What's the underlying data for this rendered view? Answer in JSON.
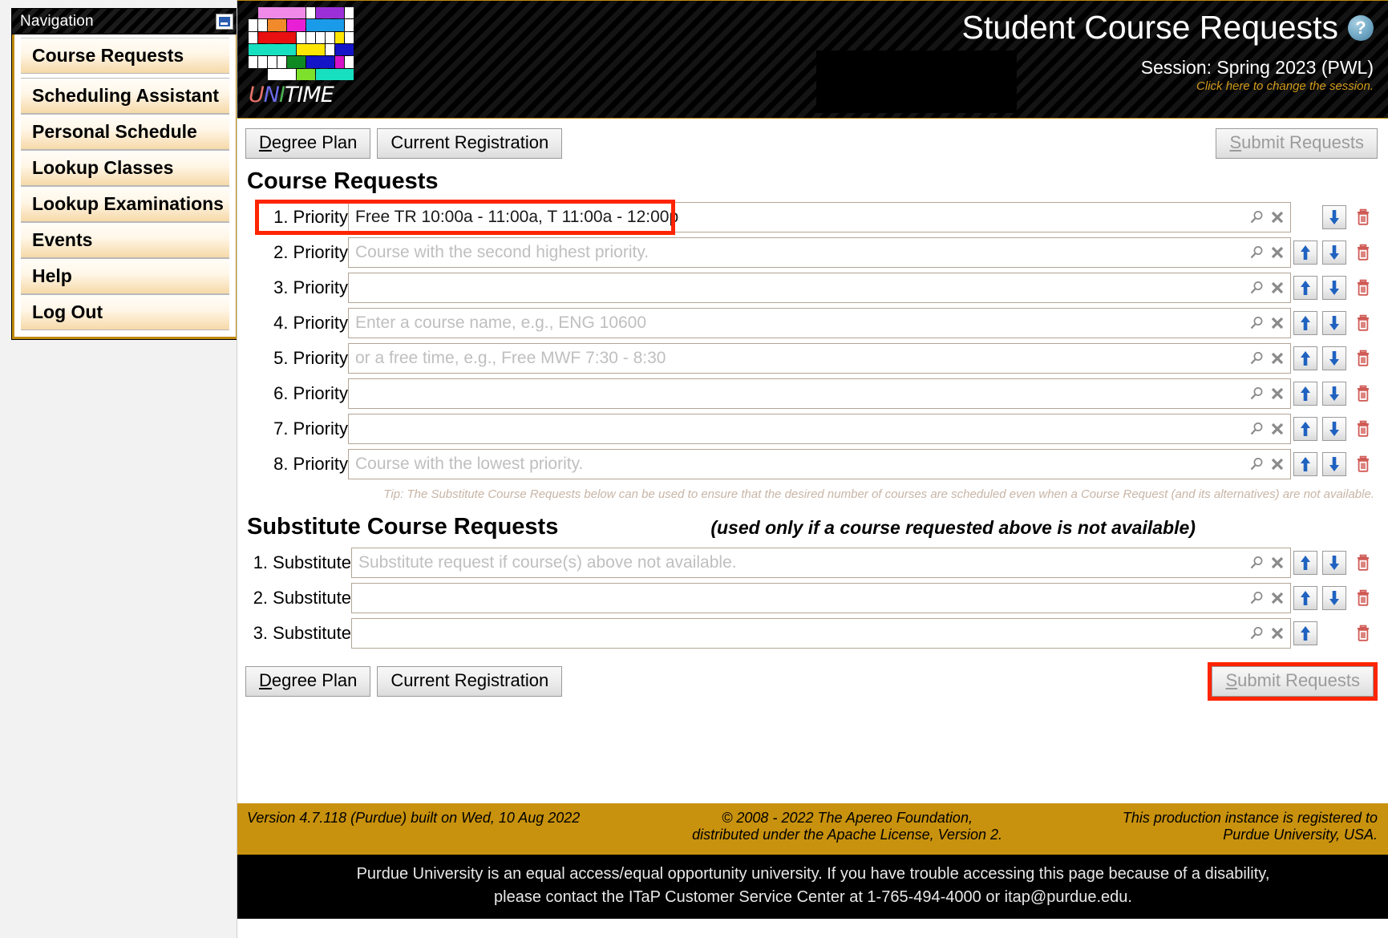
{
  "navigation": {
    "title": "Navigation",
    "minimize_icon": "minimize-icon",
    "items": [
      {
        "label": "Course Requests"
      },
      {
        "label": "Scheduling Assistant"
      },
      {
        "label": "Personal Schedule"
      },
      {
        "label": "Lookup Classes"
      },
      {
        "label": "Lookup Examinations"
      },
      {
        "label": "Events"
      },
      {
        "label": "Help"
      },
      {
        "label": "Log Out"
      }
    ]
  },
  "banner": {
    "logo_word": {
      "u": "U",
      "n": "N",
      "i": "I",
      "rest": "TIME"
    },
    "title": "Student Course Requests",
    "help_icon": "help-icon",
    "help_glyph": "?",
    "session": "Session: Spring 2023 (PWL)",
    "session_change": "Click here to change the session."
  },
  "toolbar": {
    "degree_plan_accesskey": "D",
    "degree_plan_rest": "egree Plan",
    "current_registration": "Current Registration",
    "submit_accesskey": "S",
    "submit_rest": "ubmit Requests"
  },
  "course_requests": {
    "heading": "Course Requests",
    "rows": [
      {
        "label": "1. Priority",
        "value": "Free TR 10:00a - 11:00a, T 11:00a - 12:00p",
        "placeholder": "",
        "up": false,
        "down": true,
        "delete": true
      },
      {
        "label": "2. Priority",
        "value": "",
        "placeholder": "Course with the second highest priority.",
        "up": true,
        "down": true,
        "delete": true
      },
      {
        "label": "3. Priority",
        "value": "",
        "placeholder": "",
        "up": true,
        "down": true,
        "delete": true
      },
      {
        "label": "4. Priority",
        "value": "",
        "placeholder": "Enter a course name, e.g., ENG 10600",
        "up": true,
        "down": true,
        "delete": true
      },
      {
        "label": "5. Priority",
        "value": "",
        "placeholder": "or a free time, e.g., Free MWF 7:30 - 8:30",
        "up": true,
        "down": true,
        "delete": true
      },
      {
        "label": "6. Priority",
        "value": "",
        "placeholder": "",
        "up": true,
        "down": true,
        "delete": true
      },
      {
        "label": "7. Priority",
        "value": "",
        "placeholder": "",
        "up": true,
        "down": true,
        "delete": true
      },
      {
        "label": "8. Priority",
        "value": "",
        "placeholder": "Course with the lowest priority.",
        "up": true,
        "down": true,
        "delete": true
      }
    ],
    "tip": "Tip: The Substitute Course Requests below can be used to ensure that the desired number of courses are scheduled even when a Course Request (and its alternatives) are not available."
  },
  "substitute_requests": {
    "heading": "Substitute Course Requests",
    "note": "(used only if a course requested above is not available)",
    "rows": [
      {
        "label": "1. Substitute",
        "value": "",
        "placeholder": "Substitute request if course(s) above not available.",
        "up": true,
        "down": true,
        "delete": true
      },
      {
        "label": "2. Substitute",
        "value": "",
        "placeholder": "",
        "up": true,
        "down": true,
        "delete": true
      },
      {
        "label": "3. Substitute",
        "value": "",
        "placeholder": "",
        "up": true,
        "down": false,
        "delete": true
      }
    ]
  },
  "icons": {
    "search": "search-icon",
    "clear": "clear-icon",
    "move_up": "arrow-up-icon",
    "move_down": "arrow-down-icon",
    "delete": "trash-icon"
  },
  "footer": {
    "version": "Version 4.7.118 (Purdue) built on Wed, 10 Aug 2022",
    "copyright_line1": "© 2008 - 2022 The Apereo Foundation,",
    "copyright_line2": "distributed under the Apache License, Version 2.",
    "registered_line1": "This production instance is registered to",
    "registered_line2": "Purdue University, USA.",
    "accessibility_line1": "Purdue University is an equal access/equal opportunity university. If you have trouble accessing this page because of a disability,",
    "accessibility_line2": "please contact the ITaP Customer Service Center at 1-765-494-4000 or itap@purdue.edu."
  },
  "colors": {
    "gold": "#c8920e",
    "highlight_red": "#ff2400",
    "accent_border": "#c08a10",
    "field_border": "#b3a595",
    "arrow_blue": "#1f62c0",
    "trash_red": "#d05a55"
  }
}
